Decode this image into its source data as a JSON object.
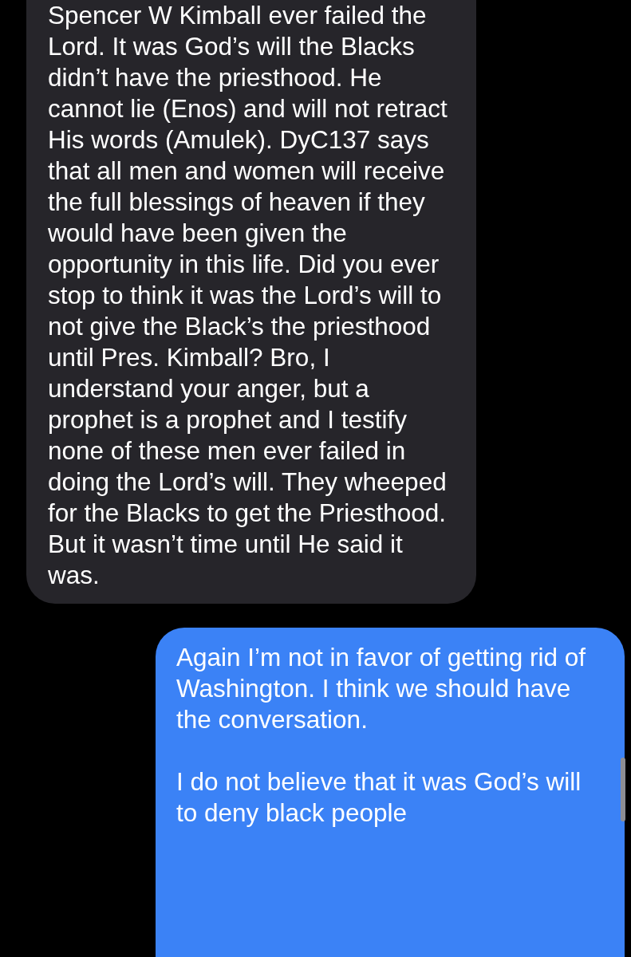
{
  "messages": [
    {
      "kind": "received",
      "paragraphs": [
        "Spencer W Kimball ever failed the Lord. It was God’s will the Blacks didn’t have the priesthood. He cannot lie (Enos) and will not retract His words (Amulek). DyC137 says that all men and women will receive the full blessings of heaven if they would have been given the opportunity in this life. Did you ever stop to think it was the Lord’s will to not give the Black’s the priesthood until Pres. Kimball? Bro, I understand your anger, but a prophet is a prophet and I testify none of these men ever failed in doing the Lord’s will. They wheeped for the Blacks to get the Priesthood. But it wasn’t time until He said it was."
      ]
    },
    {
      "kind": "sent",
      "paragraphs": [
        "Again I’m not in favor of getting rid of Washington. I think we should have the conversation.",
        "I do not believe that it was God’s will to deny black people"
      ]
    }
  ]
}
